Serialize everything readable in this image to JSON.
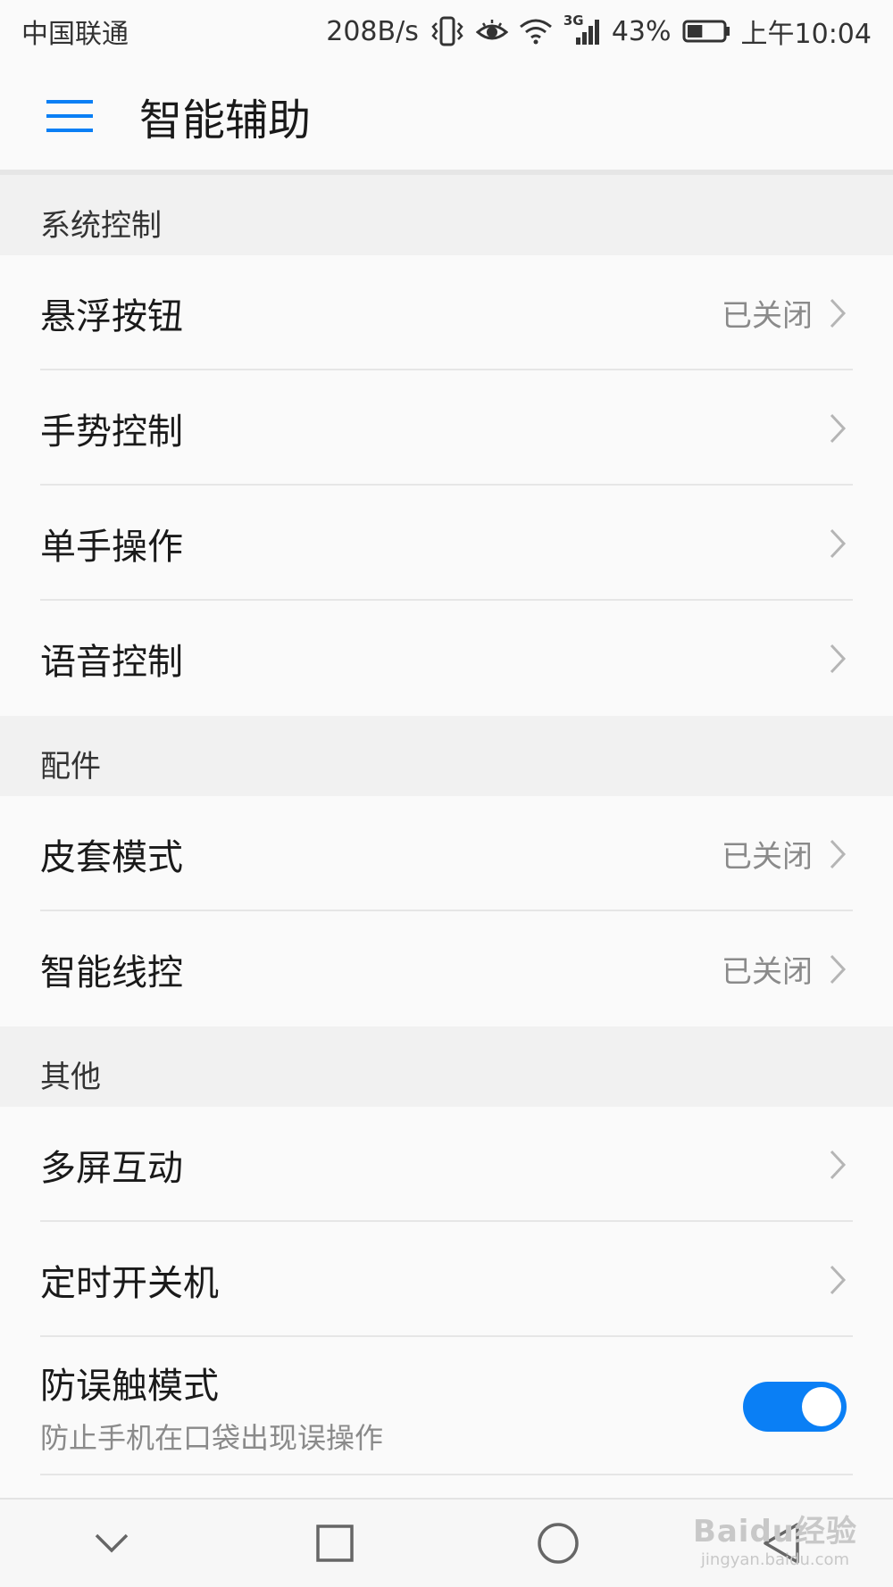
{
  "status_bar": {
    "carrier": "中国联通",
    "speed": "208B/s",
    "network": "3G",
    "battery_percent": "43%",
    "battery_level": 0.43,
    "time": "上午10:04"
  },
  "app_bar": {
    "title": "智能辅助",
    "menu_icon": "hamburger-menu-icon"
  },
  "sections": {
    "system_control": {
      "title": "系统控制",
      "items": [
        {
          "label": "悬浮按钮",
          "value": "已关闭"
        },
        {
          "label": "手势控制",
          "value": ""
        },
        {
          "label": "单手操作",
          "value": ""
        },
        {
          "label": "语音控制",
          "value": ""
        }
      ]
    },
    "accessories": {
      "title": "配件",
      "items": [
        {
          "label": "皮套模式",
          "value": "已关闭"
        },
        {
          "label": "智能线控",
          "value": "已关闭"
        }
      ]
    },
    "others": {
      "title": "其他",
      "items": [
        {
          "label": "多屏互动",
          "value": ""
        },
        {
          "label": "定时开关机",
          "value": ""
        }
      ],
      "toggle_item": {
        "label": "防误触模式",
        "subtitle": "防止手机在口袋出现误操作",
        "enabled": true
      }
    }
  },
  "nav_bar": {
    "icons": [
      "chevron-down-icon",
      "square-recents-icon",
      "circle-home-icon",
      "triangle-back-icon"
    ]
  },
  "watermark": {
    "logo": "Baidu经验",
    "url": "jingyan.baidu.com"
  },
  "colors": {
    "accent": "#0a7ff5",
    "section_bg": "#f1f1f1",
    "background": "#fafafa",
    "secondary_text": "#8a8a8a"
  }
}
